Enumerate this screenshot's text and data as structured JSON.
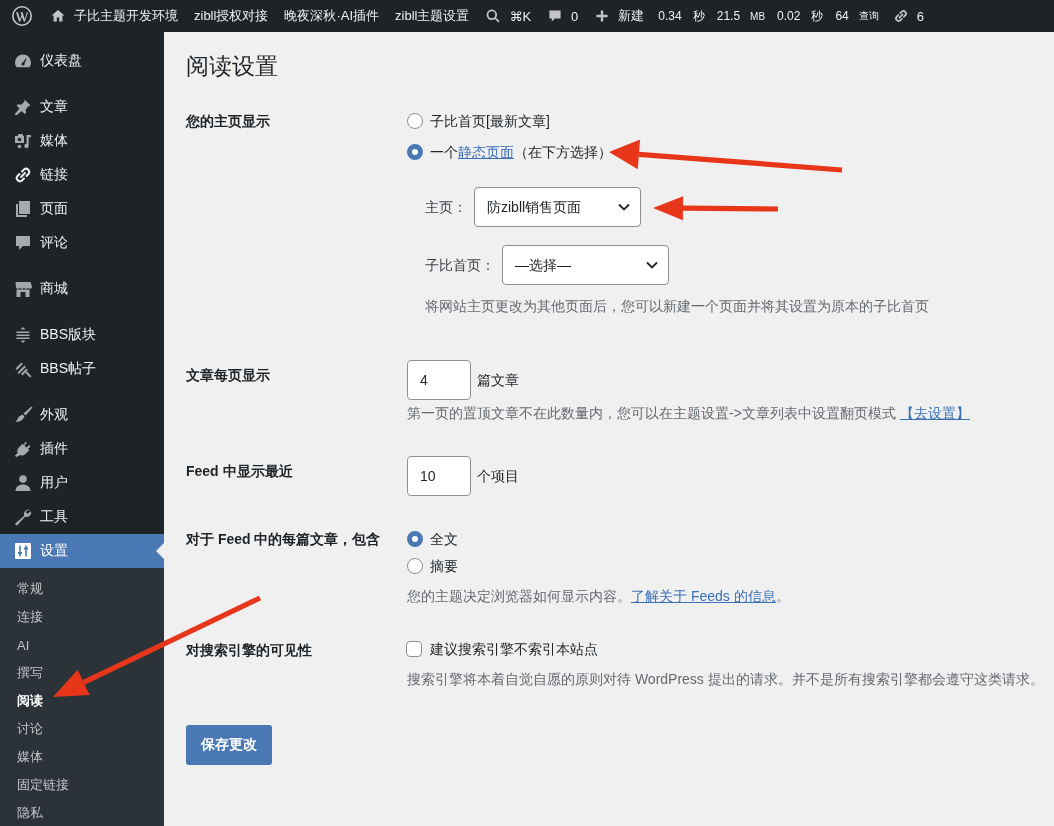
{
  "admin_bar": {
    "site_name": "子比主题开发环境",
    "menus": [
      "zibll授权对接",
      "晚夜深秋·AI插件",
      "zibll主题设置"
    ],
    "search_shortcut": "⌘K",
    "comment_count": "0",
    "new_label": "新建",
    "stats": [
      {
        "value": "0.34",
        "unit": "秒",
        "small_unit": false
      },
      {
        "value": "21.5",
        "unit": "MB",
        "small_unit": true
      },
      {
        "value": "0.02",
        "unit": "秒",
        "small_unit": false
      },
      {
        "value": "64",
        "unit": "查询",
        "small_unit": true
      }
    ],
    "link_count": "6"
  },
  "sidebar": {
    "groups": [
      {
        "items": [
          {
            "label": "仪表盘",
            "selected": false
          }
        ]
      },
      {
        "items": [
          {
            "label": "文章",
            "selected": false
          },
          {
            "label": "媒体",
            "selected": false
          },
          {
            "label": "链接",
            "selected": false
          },
          {
            "label": "页面",
            "selected": false
          },
          {
            "label": "评论",
            "selected": false
          }
        ]
      },
      {
        "items": [
          {
            "label": "商城",
            "selected": false
          }
        ]
      },
      {
        "items": [
          {
            "label": "BBS版块",
            "selected": false
          },
          {
            "label": "BBS帖子",
            "selected": false
          }
        ]
      },
      {
        "items": [
          {
            "label": "外观",
            "selected": false
          },
          {
            "label": "插件",
            "selected": false
          },
          {
            "label": "用户",
            "selected": false
          },
          {
            "label": "工具",
            "selected": false
          },
          {
            "label": "设置",
            "selected": true,
            "submenu": [
              {
                "label": "常规",
                "selected": false
              },
              {
                "label": "连接",
                "selected": false
              },
              {
                "label": "AI",
                "selected": false
              },
              {
                "label": "撰写",
                "selected": false
              },
              {
                "label": "阅读",
                "selected": true
              },
              {
                "label": "讨论",
                "selected": false
              },
              {
                "label": "媒体",
                "selected": false
              },
              {
                "label": "固定链接",
                "selected": false
              },
              {
                "label": "隐私",
                "selected": false
              }
            ]
          }
        ]
      }
    ]
  },
  "page": {
    "title": "阅读设置",
    "rows": [
      {
        "kind": "front_page",
        "label": "您的主页显示",
        "options": [
          {
            "text": "子比首页[最新文章]",
            "selected": false
          },
          {
            "text": "一个",
            "link": "静态页面",
            "after": "（在下方选择）",
            "selected": true
          }
        ],
        "selects": [
          {
            "label": "主页：",
            "value": "防zibll销售页面"
          },
          {
            "label": "子比首页：",
            "value": "—选择—"
          }
        ],
        "description": "将网站主页更改为其他页面后，您可以新建一个页面并将其设置为原本的子比首页"
      },
      {
        "kind": "number",
        "label": "文章每页显示",
        "value": "4",
        "unit": "篇文章",
        "description": "第一页的置顶文章不在此数量内，您可以在主题设置->文章列表中设置翻页模式",
        "link": "【去设置】"
      },
      {
        "kind": "number",
        "label": "Feed 中显示最近",
        "value": "10",
        "unit": "个项目"
      },
      {
        "kind": "radios",
        "label": "对于 Feed 中的每篇文章，包含",
        "options": [
          {
            "text": "全文",
            "selected": true
          },
          {
            "text": "摘要",
            "selected": false
          }
        ],
        "description": "您的主题决定浏览器如何显示内容。",
        "link": "了解关于 Feeds 的信息",
        "after": "。"
      },
      {
        "kind": "checkbox",
        "label": "对搜索引擎的可见性",
        "text": "建议搜索引擎不索引本站点",
        "checked": false,
        "description": "搜索引擎将本着自觉自愿的原则对待 WordPress 提出的请求。并不是所有搜索引擎都会遵守这类请求。"
      }
    ],
    "submit": "保存更改"
  }
}
